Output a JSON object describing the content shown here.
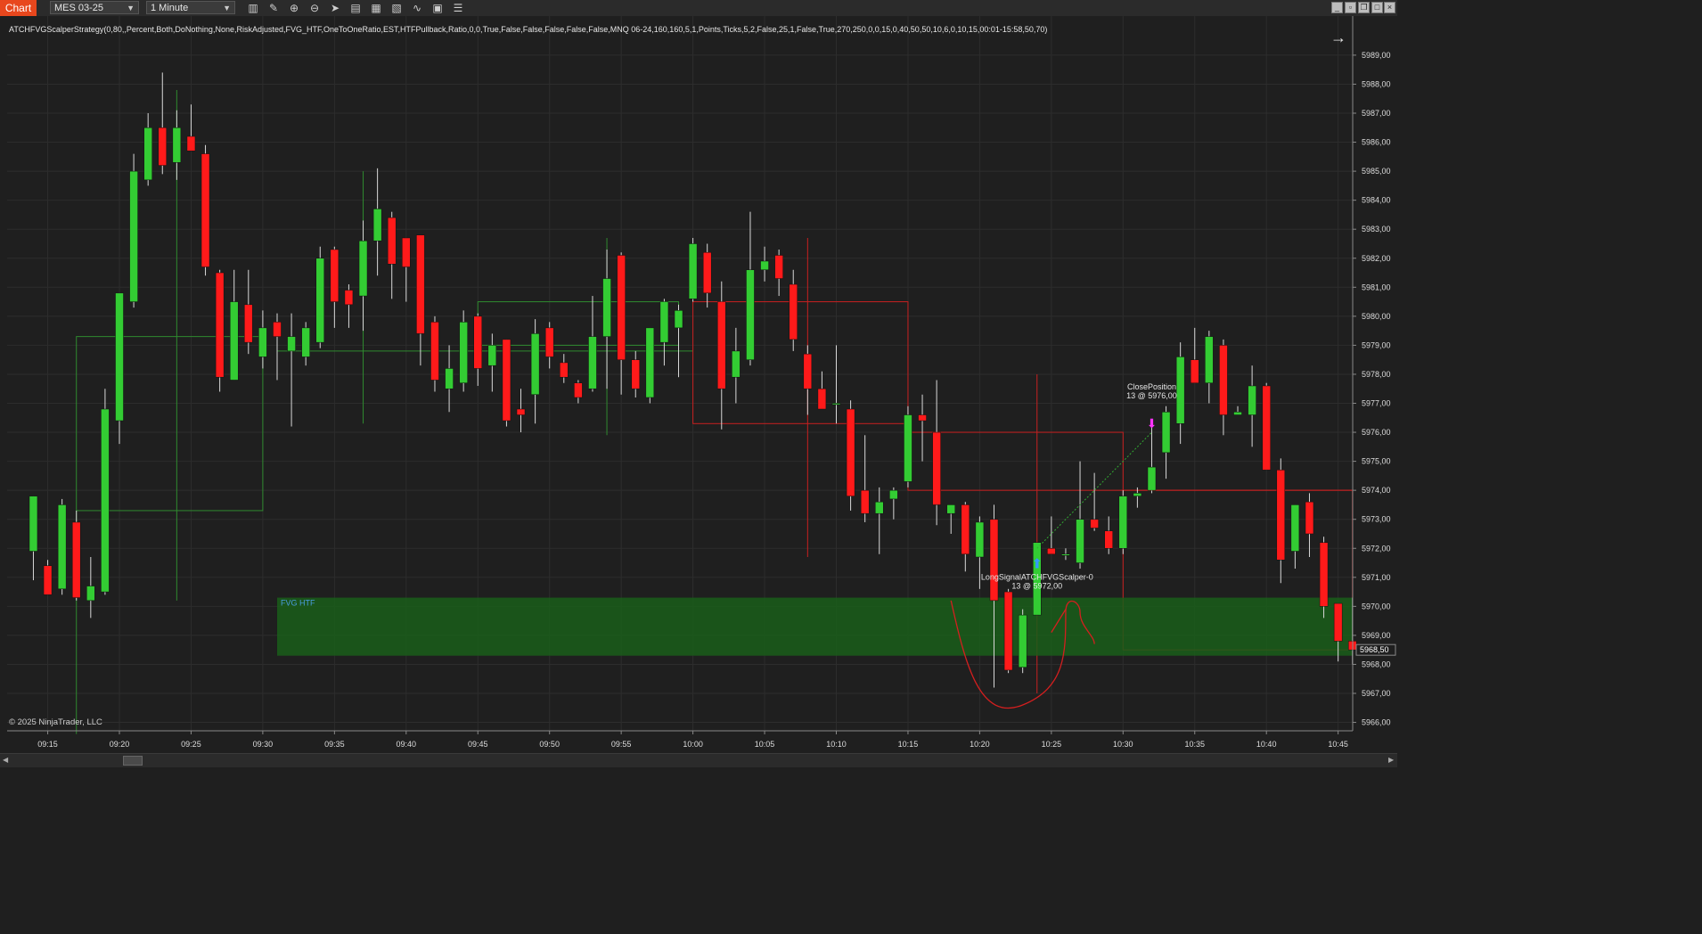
{
  "toolbar": {
    "chart_tab": "Chart",
    "instrument": "MES 03-25",
    "interval": "1 Minute",
    "icons": [
      "bar-type-icon",
      "drawing-pencil-icon",
      "zoom-in-icon",
      "zoom-out-icon",
      "pointer-icon",
      "data-box-icon",
      "chart-properties-icon",
      "strategies-icon",
      "indicators-icon",
      "templates-icon",
      "list-icon"
    ]
  },
  "strategy_label": "ATCHFVGScalperStrategy(0,80,,Percent,Both,DoNothing,None,RiskAdjusted,FVG_HTF,OneToOneRatio,EST,HTFPullback,Ratio,0,0,True,False,False,False,False,False,MNQ 06-24,160,160,5,1,Points,Ticks,5,2,False,25,1,False,True,270,250,0,0,15,0,40,50,50,10,6,0,10,15,00:01-15:58,50,70)",
  "copyright": "© 2025 NinjaTrader, LLC",
  "colors": {
    "background": "#1f1f1f",
    "up": "#33cc33",
    "down": "#ff1a1a",
    "fvg_zone": "#1a5e1a",
    "accent": "#e8471d",
    "signal_blue": "#3399ff",
    "close_magenta": "#ff33ff"
  },
  "chart_data": {
    "type": "candlestick",
    "symbol": "MES 03-25",
    "interval": "1 Minute",
    "x_ticks": [
      "09:15",
      "09:20",
      "09:25",
      "09:30",
      "09:35",
      "09:40",
      "09:45",
      "09:50",
      "09:55",
      "10:00",
      "10:05",
      "10:10",
      "10:15",
      "10:20",
      "10:25",
      "10:30",
      "10:35",
      "10:40",
      "10:45"
    ],
    "y_ticks": [
      "5966,00",
      "5967,00",
      "5968,00",
      "5969,00",
      "5970,00",
      "5971,00",
      "5972,00",
      "5973,00",
      "5974,00",
      "5975,00",
      "5976,00",
      "5977,00",
      "5978,00",
      "5979,00",
      "5980,00",
      "5981,00",
      "5982,00",
      "5983,00",
      "5984,00",
      "5985,00",
      "5986,00",
      "5987,00",
      "5988,00",
      "5989,00"
    ],
    "ylim": [
      5965.6,
      5989.6
    ],
    "last_price_label": "5968,50",
    "last_price": 5968.5,
    "grid": true,
    "candles": [
      {
        "t": "09:14",
        "o": 5971.9,
        "h": 5972.6,
        "l": 5970.9,
        "c": 5973.8
      },
      {
        "t": "09:15",
        "o": 5971.4,
        "h": 5971.6,
        "l": 5970.9,
        "c": 5970.4
      },
      {
        "t": "09:16",
        "o": 5970.6,
        "h": 5973.7,
        "l": 5970.4,
        "c": 5973.5
      },
      {
        "t": "09:17",
        "o": 5972.9,
        "h": 5973.3,
        "l": 5970.2,
        "c": 5970.3
      },
      {
        "t": "09:18",
        "o": 5970.2,
        "h": 5971.7,
        "l": 5969.6,
        "c": 5970.7
      },
      {
        "t": "09:19",
        "o": 5970.5,
        "h": 5977.5,
        "l": 5970.4,
        "c": 5976.8
      },
      {
        "t": "09:20",
        "o": 5976.4,
        "h": 5980.6,
        "l": 5975.6,
        "c": 5980.8
      },
      {
        "t": "09:21",
        "o": 5980.5,
        "h": 5985.6,
        "l": 5980.3,
        "c": 5985.0
      },
      {
        "t": "09:22",
        "o": 5984.7,
        "h": 5987.0,
        "l": 5984.5,
        "c": 5986.5
      },
      {
        "t": "09:23",
        "o": 5986.5,
        "h": 5988.4,
        "l": 5984.9,
        "c": 5985.2
      },
      {
        "t": "09:24",
        "o": 5985.3,
        "h": 5987.1,
        "l": 5984.7,
        "c": 5986.5
      },
      {
        "t": "09:25",
        "o": 5986.2,
        "h": 5987.3,
        "l": 5985.8,
        "c": 5985.7
      },
      {
        "t": "09:26",
        "o": 5985.6,
        "h": 5985.9,
        "l": 5981.4,
        "c": 5981.7
      },
      {
        "t": "09:27",
        "o": 5981.5,
        "h": 5981.6,
        "l": 5977.4,
        "c": 5977.9
      },
      {
        "t": "09:28",
        "o": 5977.8,
        "h": 5981.6,
        "l": 5977.8,
        "c": 5980.5
      },
      {
        "t": "09:29",
        "o": 5980.4,
        "h": 5981.6,
        "l": 5978.7,
        "c": 5979.1
      },
      {
        "t": "09:30",
        "o": 5978.6,
        "h": 5980.2,
        "l": 5978.2,
        "c": 5979.6
      },
      {
        "t": "09:31",
        "o": 5979.8,
        "h": 5980.1,
        "l": 5977.8,
        "c": 5979.3
      },
      {
        "t": "09:32",
        "o": 5978.8,
        "h": 5980.1,
        "l": 5976.2,
        "c": 5979.3
      },
      {
        "t": "09:33",
        "o": 5978.6,
        "h": 5979.8,
        "l": 5978.3,
        "c": 5979.6
      },
      {
        "t": "09:34",
        "o": 5979.1,
        "h": 5982.4,
        "l": 5978.9,
        "c": 5982.0
      },
      {
        "t": "09:35",
        "o": 5982.3,
        "h": 5982.4,
        "l": 5979.6,
        "c": 5980.5
      },
      {
        "t": "09:36",
        "o": 5980.9,
        "h": 5981.1,
        "l": 5979.6,
        "c": 5980.4
      },
      {
        "t": "09:37",
        "o": 5980.7,
        "h": 5983.3,
        "l": 5979.5,
        "c": 5982.6
      },
      {
        "t": "09:38",
        "o": 5982.6,
        "h": 5985.1,
        "l": 5981.4,
        "c": 5983.7
      },
      {
        "t": "09:39",
        "o": 5983.4,
        "h": 5983.6,
        "l": 5980.6,
        "c": 5981.8
      },
      {
        "t": "09:40",
        "o": 5982.7,
        "h": 5982.5,
        "l": 5980.5,
        "c": 5981.7
      },
      {
        "t": "09:41",
        "o": 5982.8,
        "h": 5981.8,
        "l": 5978.3,
        "c": 5979.4
      },
      {
        "t": "09:42",
        "o": 5979.8,
        "h": 5980.0,
        "l": 5977.4,
        "c": 5977.8
      },
      {
        "t": "09:43",
        "o": 5977.5,
        "h": 5979.0,
        "l": 5976.7,
        "c": 5978.2
      },
      {
        "t": "09:44",
        "o": 5977.7,
        "h": 5980.2,
        "l": 5977.4,
        "c": 5979.8
      },
      {
        "t": "09:45",
        "o": 5980.0,
        "h": 5980.1,
        "l": 5977.6,
        "c": 5978.2
      },
      {
        "t": "09:46",
        "o": 5978.3,
        "h": 5979.4,
        "l": 5977.4,
        "c": 5979.0
      },
      {
        "t": "09:47",
        "o": 5979.2,
        "h": 5979.2,
        "l": 5976.2,
        "c": 5976.4
      },
      {
        "t": "09:48",
        "o": 5976.8,
        "h": 5977.5,
        "l": 5976.0,
        "c": 5976.6
      },
      {
        "t": "09:49",
        "o": 5977.3,
        "h": 5979.9,
        "l": 5976.3,
        "c": 5979.4
      },
      {
        "t": "09:50",
        "o": 5979.6,
        "h": 5979.8,
        "l": 5978.2,
        "c": 5978.6
      },
      {
        "t": "09:51",
        "o": 5978.4,
        "h": 5978.7,
        "l": 5977.7,
        "c": 5977.9
      },
      {
        "t": "09:52",
        "o": 5977.7,
        "h": 5977.8,
        "l": 5977.0,
        "c": 5977.2
      },
      {
        "t": "09:53",
        "o": 5977.5,
        "h": 5980.7,
        "l": 5977.4,
        "c": 5979.3
      },
      {
        "t": "09:54",
        "o": 5979.3,
        "h": 5982.3,
        "l": 5977.5,
        "c": 5981.3
      },
      {
        "t": "09:55",
        "o": 5982.1,
        "h": 5982.2,
        "l": 5977.3,
        "c": 5978.5
      },
      {
        "t": "09:56",
        "o": 5978.5,
        "h": 5978.8,
        "l": 5977.2,
        "c": 5977.5
      },
      {
        "t": "09:57",
        "o": 5977.2,
        "h": 5979.5,
        "l": 5977.0,
        "c": 5979.6
      },
      {
        "t": "09:58",
        "o": 5979.1,
        "h": 5980.6,
        "l": 5978.3,
        "c": 5980.5
      },
      {
        "t": "09:59",
        "o": 5979.6,
        "h": 5980.4,
        "l": 5977.9,
        "c": 5980.2
      },
      {
        "t": "10:00",
        "o": 5980.6,
        "h": 5982.7,
        "l": 5980.5,
        "c": 5982.5
      },
      {
        "t": "10:01",
        "o": 5982.2,
        "h": 5982.5,
        "l": 5980.3,
        "c": 5980.8
      },
      {
        "t": "10:02",
        "o": 5980.5,
        "h": 5981.2,
        "l": 5976.1,
        "c": 5977.5
      },
      {
        "t": "10:03",
        "o": 5977.9,
        "h": 5979.6,
        "l": 5977.0,
        "c": 5978.8
      },
      {
        "t": "10:04",
        "o": 5978.5,
        "h": 5983.6,
        "l": 5978.3,
        "c": 5981.6
      },
      {
        "t": "10:05",
        "o": 5981.6,
        "h": 5982.4,
        "l": 5981.2,
        "c": 5981.9
      },
      {
        "t": "10:06",
        "o": 5982.1,
        "h": 5982.3,
        "l": 5980.7,
        "c": 5981.3
      },
      {
        "t": "10:07",
        "o": 5981.1,
        "h": 5981.6,
        "l": 5978.8,
        "c": 5979.2
      },
      {
        "t": "10:08",
        "o": 5978.7,
        "h": 5979.0,
        "l": 5976.6,
        "c": 5977.5
      },
      {
        "t": "10:09",
        "o": 5977.5,
        "h": 5978.1,
        "l": 5976.9,
        "c": 5976.8
      },
      {
        "t": "10:10",
        "o": 5977.0,
        "h": 5979.0,
        "l": 5976.3,
        "c": 5977.0
      },
      {
        "t": "10:11",
        "o": 5976.8,
        "h": 5977.1,
        "l": 5973.3,
        "c": 5973.8
      },
      {
        "t": "10:12",
        "o": 5974.0,
        "h": 5975.9,
        "l": 5972.9,
        "c": 5973.2
      },
      {
        "t": "10:13",
        "o": 5973.2,
        "h": 5974.1,
        "l": 5971.8,
        "c": 5973.6
      },
      {
        "t": "10:14",
        "o": 5973.7,
        "h": 5974.1,
        "l": 5973.0,
        "c": 5974.0
      },
      {
        "t": "10:15",
        "o": 5974.3,
        "h": 5976.9,
        "l": 5974.1,
        "c": 5976.6
      },
      {
        "t": "10:16",
        "o": 5976.6,
        "h": 5977.3,
        "l": 5975.0,
        "c": 5976.4
      },
      {
        "t": "10:17",
        "o": 5976.0,
        "h": 5977.8,
        "l": 5972.8,
        "c": 5973.5
      },
      {
        "t": "10:18",
        "o": 5973.2,
        "h": 5973.5,
        "l": 5972.5,
        "c": 5973.5
      },
      {
        "t": "10:19",
        "o": 5973.5,
        "h": 5973.6,
        "l": 5971.2,
        "c": 5971.8
      },
      {
        "t": "10:20",
        "o": 5971.7,
        "h": 5973.1,
        "l": 5970.6,
        "c": 5972.9
      },
      {
        "t": "10:21",
        "o": 5973.0,
        "h": 5973.5,
        "l": 5967.2,
        "c": 5970.2
      },
      {
        "t": "10:22",
        "o": 5970.5,
        "h": 5970.6,
        "l": 5967.7,
        "c": 5967.8
      },
      {
        "t": "10:23",
        "o": 5967.9,
        "h": 5969.9,
        "l": 5967.7,
        "c": 5969.7
      },
      {
        "t": "10:24",
        "o": 5969.7,
        "h": 5972.2,
        "l": 5969.7,
        "c": 5972.2
      },
      {
        "t": "10:25",
        "o": 5972.0,
        "h": 5973.1,
        "l": 5971.8,
        "c": 5971.8
      },
      {
        "t": "10:26",
        "o": 5971.8,
        "h": 5972.0,
        "l": 5971.6,
        "c": 5971.8
      },
      {
        "t": "10:27",
        "o": 5971.5,
        "h": 5975.0,
        "l": 5971.3,
        "c": 5973.0
      },
      {
        "t": "10:28",
        "o": 5973.0,
        "h": 5974.6,
        "l": 5972.6,
        "c": 5972.7
      },
      {
        "t": "10:29",
        "o": 5972.6,
        "h": 5973.1,
        "l": 5971.8,
        "c": 5972.0
      },
      {
        "t": "10:30",
        "o": 5972.0,
        "h": 5974.0,
        "l": 5971.8,
        "c": 5973.8
      },
      {
        "t": "10:31",
        "o": 5973.8,
        "h": 5974.1,
        "l": 5973.4,
        "c": 5973.9
      },
      {
        "t": "10:32",
        "o": 5974.0,
        "h": 5976.3,
        "l": 5973.9,
        "c": 5974.8
      },
      {
        "t": "10:33",
        "o": 5975.3,
        "h": 5976.9,
        "l": 5974.4,
        "c": 5976.7
      },
      {
        "t": "10:34",
        "o": 5976.3,
        "h": 5979.1,
        "l": 5975.6,
        "c": 5978.6
      },
      {
        "t": "10:35",
        "o": 5978.5,
        "h": 5979.6,
        "l": 5977.7,
        "c": 5977.7
      },
      {
        "t": "10:36",
        "o": 5977.7,
        "h": 5979.5,
        "l": 5977.0,
        "c": 5979.3
      },
      {
        "t": "10:37",
        "o": 5979.0,
        "h": 5979.2,
        "l": 5975.9,
        "c": 5976.6
      },
      {
        "t": "10:38",
        "o": 5976.6,
        "h": 5976.9,
        "l": 5976.7,
        "c": 5976.7
      },
      {
        "t": "10:39",
        "o": 5976.6,
        "h": 5978.3,
        "l": 5975.5,
        "c": 5977.6
      },
      {
        "t": "10:40",
        "o": 5977.6,
        "h": 5977.7,
        "l": 5974.8,
        "c": 5974.7
      },
      {
        "t": "10:41",
        "o": 5974.7,
        "h": 5975.1,
        "l": 5970.8,
        "c": 5971.6
      },
      {
        "t": "10:42",
        "o": 5971.9,
        "h": 5973.5,
        "l": 5971.3,
        "c": 5973.5
      },
      {
        "t": "10:43",
        "o": 5973.6,
        "h": 5973.9,
        "l": 5971.7,
        "c": 5972.5
      },
      {
        "t": "10:44",
        "o": 5972.2,
        "h": 5972.4,
        "l": 5969.6,
        "c": 5970.0
      },
      {
        "t": "10:45",
        "o": 5970.1,
        "h": 5970.1,
        "l": 5968.1,
        "c": 5968.8
      },
      {
        "t": "10:46",
        "o": 5968.8,
        "h": 5970.3,
        "l": 5968.0,
        "c": 5968.5
      }
    ],
    "fvg_zone": {
      "label": "FVG HTF",
      "from": "09:31",
      "to": "10:46",
      "high": 5970.3,
      "low": 5968.3
    },
    "annotations": [
      {
        "type": "entry",
        "label": "LongSignalATCHFVGScalper-0",
        "detail": "13 @ 5972,00",
        "t": "10:24",
        "price": 5972.0
      },
      {
        "type": "exit",
        "label": "ClosePosition",
        "detail": "13 @ 5976,00",
        "t": "10:32",
        "price": 5976.0
      }
    ]
  }
}
